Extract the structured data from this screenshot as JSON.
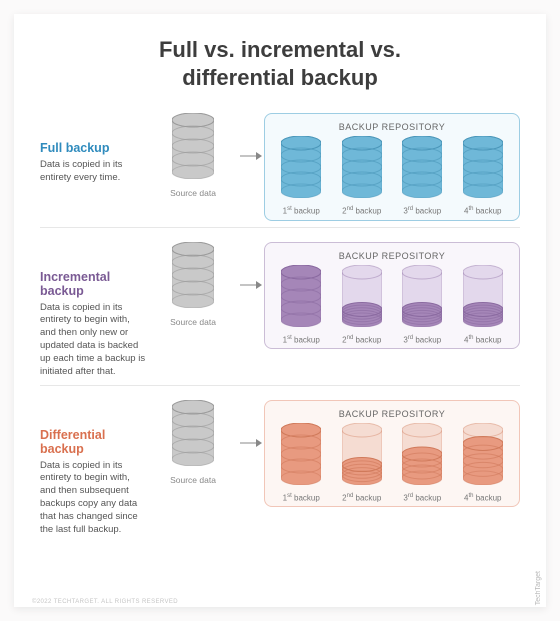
{
  "title_line1": "Full vs. incremental vs.",
  "title_line2": "differential backup",
  "repo_label": "BACKUP REPOSITORY",
  "source_label": "Source data",
  "backups": [
    {
      "ord": "1",
      "suf": "st"
    },
    {
      "ord": "2",
      "suf": "nd"
    },
    {
      "ord": "3",
      "suf": "rd"
    },
    {
      "ord": "4",
      "suf": "th"
    }
  ],
  "rows": [
    {
      "key": "full",
      "title": "Full backup",
      "desc": "Data is copied in its entirety every time.",
      "color_class": "t-blue",
      "repo_class": "b-blue",
      "fill": "#6fb8d8",
      "outline": "#4a96b9",
      "ghost": "#cfe6f1",
      "fills": [
        1,
        1,
        1,
        1
      ]
    },
    {
      "key": "incremental",
      "title": "Incremental backup",
      "desc": "Data is copied in its entirety to begin with, and then only new or updated data is backed up each time a backup is initiated after that.",
      "color_class": "t-purple",
      "repo_class": "b-purple",
      "fill": "#a586b8",
      "outline": "#8a6aa0",
      "ghost": "#e3d8ec",
      "fills": [
        1,
        0.22,
        0.22,
        0.22
      ]
    },
    {
      "key": "differential",
      "title": "Differential backup",
      "desc": "Data is copied in its entirety to begin with, and then subsequent backups copy any data that has changed since the last full backup.",
      "color_class": "t-coral",
      "repo_class": "b-coral",
      "fill": "#e89a80",
      "outline": "#d07a5b",
      "ghost": "#f5dcd2",
      "fills": [
        1,
        0.28,
        0.5,
        0.72
      ]
    }
  ],
  "credit": "TechTarget",
  "credit2": "©2022 TECHTARGET. ALL RIGHTS RESERVED"
}
